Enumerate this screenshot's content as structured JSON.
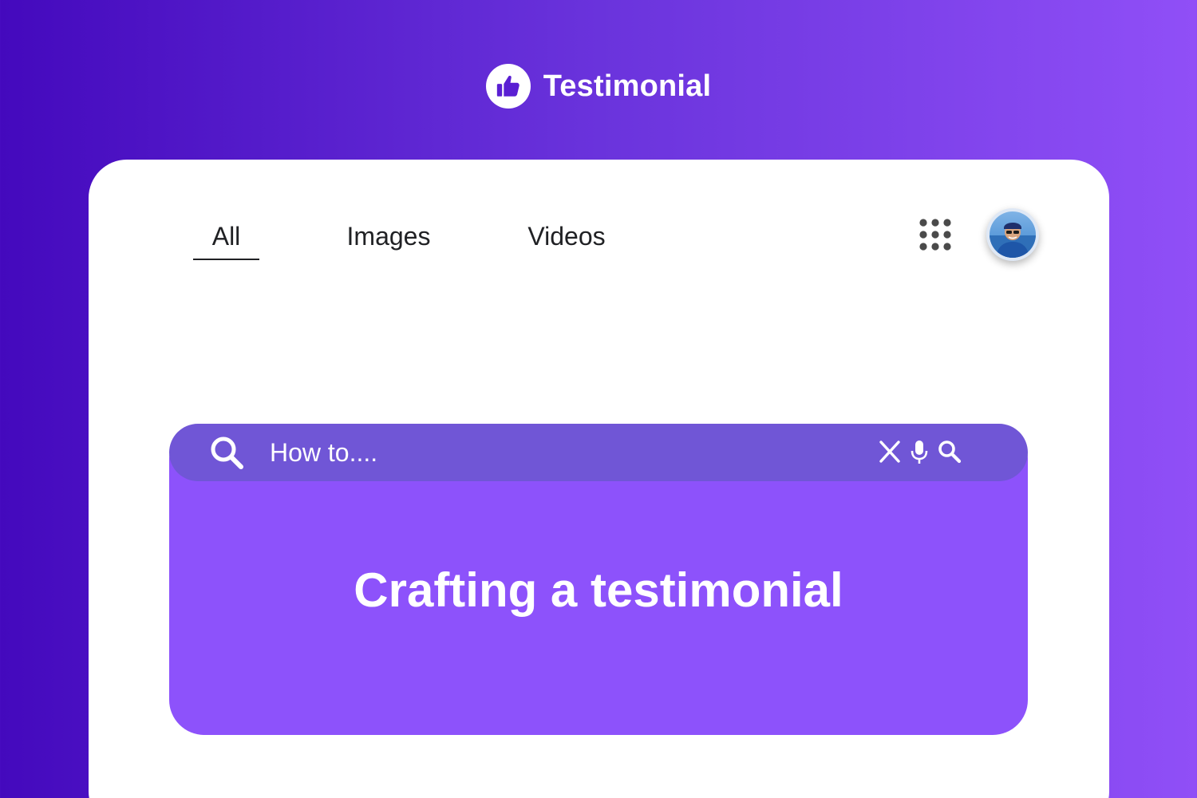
{
  "brand": {
    "name": "Testimonial",
    "logo_icon": "thumbs-up-icon"
  },
  "tabs": [
    {
      "label": "All",
      "active": true
    },
    {
      "label": "Images",
      "active": false
    },
    {
      "label": "Videos",
      "active": false
    }
  ],
  "header_actions": {
    "apps_icon": "apps-grid-icon",
    "avatar": "user-avatar"
  },
  "search": {
    "placeholder": "How to....",
    "value": "",
    "leading_icon": "search-icon",
    "clear_icon": "close-icon",
    "voice_icon": "microphone-icon",
    "submit_icon": "search-icon"
  },
  "result": {
    "title": "Crafting a testimonial"
  },
  "colors": {
    "background_gradient": [
      "#4409bd",
      "#904ff7"
    ],
    "card": "#ffffff",
    "search_bar": "#7056d6",
    "result_card": "#8d52fb",
    "text_dark": "#202124"
  }
}
